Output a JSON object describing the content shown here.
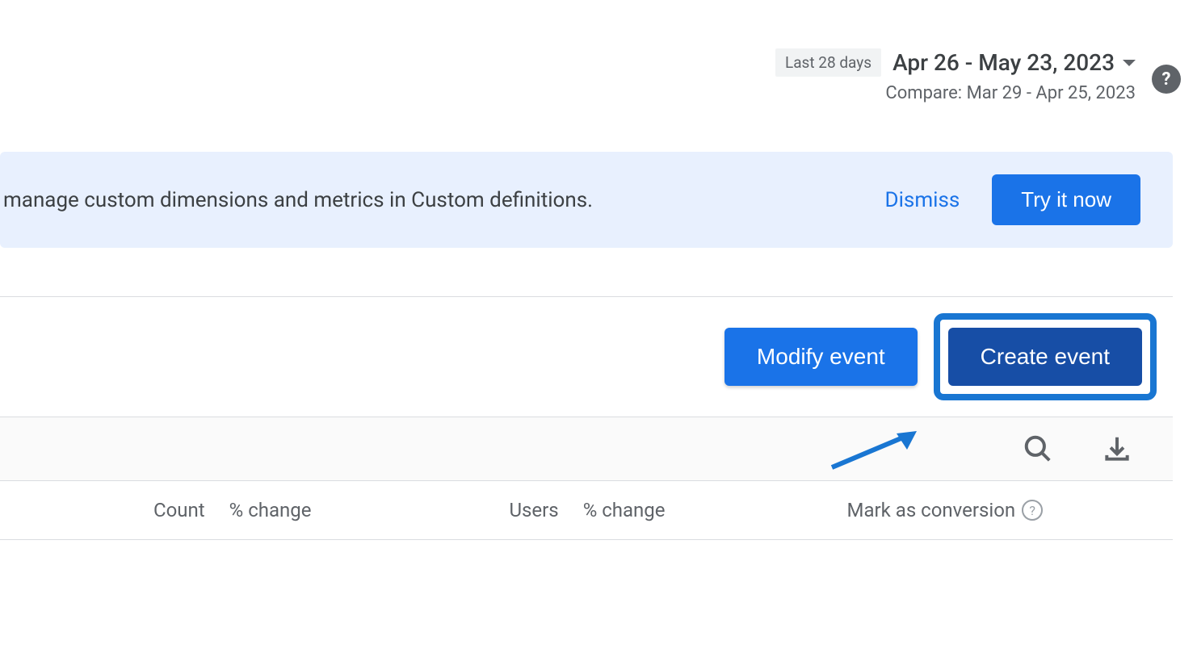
{
  "header": {
    "date_badge": "Last 28 days",
    "date_range": "Apr 26 - May 23, 2023",
    "compare_text": "Compare: Mar 29 - Apr 25, 2023"
  },
  "banner": {
    "text": "manage custom dimensions and metrics in Custom definitions.",
    "dismiss_label": "Dismiss",
    "try_label": "Try it now"
  },
  "buttons": {
    "modify_label": "Modify event",
    "create_label": "Create event"
  },
  "table": {
    "count_label": "Count",
    "pct_change_label": "% change",
    "users_label": "Users",
    "mark_conversion_label": "Mark as conversion"
  }
}
